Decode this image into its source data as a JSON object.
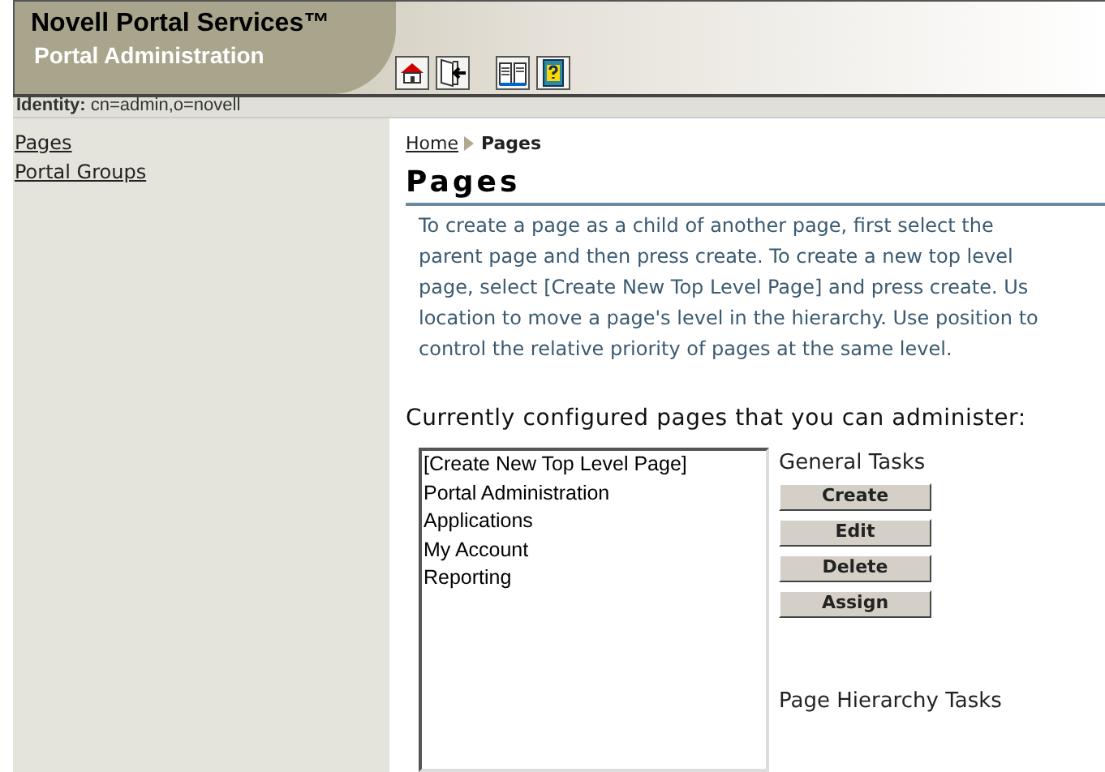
{
  "header": {
    "product": "Novell Portal Services™",
    "subtitle": "Portal Administration",
    "toolbar": [
      {
        "kind": "home"
      },
      {
        "kind": "exit"
      },
      {
        "kind": "book"
      },
      {
        "kind": "help"
      }
    ]
  },
  "identity": "**Identity:** cn=admin,o=novell",
  "sidebar": {
    "items": [
      {
        "label": "Pages"
      },
      {
        "label": "Portal Groups"
      }
    ]
  },
  "breadcrumb": {
    "home": "Home",
    "current": "Pages"
  },
  "title": "Pages",
  "description_lines": [
    "To create a page as a child of another page, first select the",
    "parent page and then press create. To create a new top level",
    "page, select [Create New Top Level Page] and press create. Us",
    "location to move a page's level in the hierarchy. Use position to",
    "control the relative priority of pages at the same level."
  ],
  "list_heading": "Currently configured pages that you can administer:",
  "pages_list": [
    "[Create New Top Level Page]",
    "Portal Administration",
    "Applications",
    "My Account",
    "Reporting"
  ],
  "general_tasks": {
    "heading": "General Tasks",
    "buttons": [
      "Create",
      "Edit",
      "Delete",
      "Assign"
    ]
  },
  "hierarchy_tasks": {
    "heading": "Page Hierarchy Tasks"
  }
}
